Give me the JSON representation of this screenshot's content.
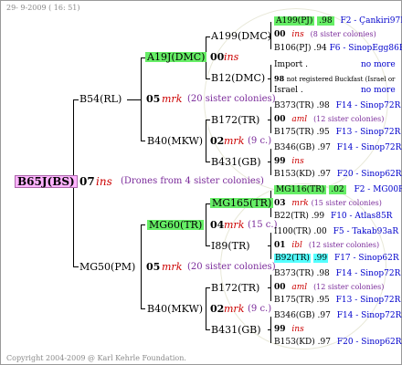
{
  "header": {
    "date": "29- 9-2009 ( 16: 51)"
  },
  "footer": {
    "copyright": "Copyright 2004-2009 @ Karl Kehrle Foundation."
  },
  "root": {
    "id": "B65J(BS)",
    "gen": "07",
    "species": "ins",
    "note": "(Drones from 4 sister colonies)"
  },
  "g1": [
    {
      "id": "B54(RL)"
    },
    {
      "id": "MG50(PM)",
      "gen": "05",
      "species": "mrk",
      "note": "(20 sister colonies)"
    }
  ],
  "g1a": {
    "gen": "05",
    "species": "mrk",
    "note": "(20 sister colonies)"
  },
  "g2": {
    "a": {
      "id": "A19J(DMC)"
    },
    "b": {
      "id": "B40(MKW)",
      "gen": "02",
      "species": "mrk",
      "note": "(9 c.)"
    },
    "c": {
      "id": "MG60(TR)",
      "gen": "04",
      "species": "mrk",
      "note": "(15 c.)"
    },
    "d": {
      "id": "B40(MKW)",
      "gen": "02",
      "species": "mrk",
      "note": "(9 c.)"
    }
  },
  "g3": {
    "a1": {
      "id": "A199(DMC)"
    },
    "a2": {
      "id": "B12(DMC)"
    },
    "b1": {
      "id": "B172(TR)"
    },
    "b2": {
      "id": "B431(GB)"
    },
    "c1": {
      "id": "MG165(TR)"
    },
    "c2": {
      "id": "I89(TR)"
    },
    "d1": {
      "id": "B172(TR)"
    },
    "d2": {
      "id": "B431(GB)"
    }
  },
  "g3a1_line": {
    "gen": "00",
    "species": "ins"
  },
  "g4": [
    {
      "id": "A199(PJ)",
      "val": ".98",
      "loc": "F2 - Çankiri97R"
    },
    {
      "gen": "00",
      "species": "ins",
      "note": "(8 sister colonies)"
    },
    {
      "id": "B106(PJ)",
      "val": ".94",
      "loc": "F6 - SinopEgg86R"
    },
    {
      "id": "Import",
      "dot": ".",
      "loc": "no more"
    },
    {
      "gen": "98",
      "note": "not registered Buckfast (Israel or"
    },
    {
      "id": "Israel",
      "dot": ".",
      "loc": "no more"
    },
    {
      "id": "B373(TR)",
      "val": ".98",
      "loc": "F14 - Sinop72R"
    },
    {
      "gen": "00",
      "species": "aml",
      "note": "(12 sister colonies)"
    },
    {
      "id": "B175(TR)",
      "val": ".95",
      "loc": "F13 - Sinop72R"
    },
    {
      "id": "B346(GB)",
      "val": ".97",
      "loc": "F14 - Sinop72R"
    },
    {
      "gen": "99",
      "species": "ins"
    },
    {
      "id": "B153(KD)",
      "val": ".97",
      "loc": "F20 - Sinop62R"
    },
    {
      "id": "MG116(TR)",
      "val": ".02",
      "loc": "F2 - MG00R"
    },
    {
      "gen": "03",
      "species": "mrk",
      "note": "(15 sister colonies)"
    },
    {
      "id": "B22(TR)",
      "val": ".99",
      "loc": "F10 - Atlas85R"
    },
    {
      "id": "I100(TR)",
      "val": ".00",
      "loc": "F5 - Takab93aR"
    },
    {
      "gen": "01",
      "species": "ibl",
      "note": "(12 sister colonies)"
    },
    {
      "id": "B92(TR)",
      "val": ".99",
      "loc": "F17 - Sinop62R"
    },
    {
      "id": "B373(TR)",
      "val": ".98",
      "loc": "F14 - Sinop72R"
    },
    {
      "gen": "00",
      "species": "aml",
      "note": "(12 sister colonies)"
    },
    {
      "id": "B175(TR)",
      "val": ".95",
      "loc": "F13 - Sinop72R"
    },
    {
      "id": "B346(GB)",
      "val": ".97",
      "loc": "F14 - Sinop72R"
    },
    {
      "gen": "99",
      "species": "ins"
    },
    {
      "id": "B153(KD)",
      "val": ".97",
      "loc": "F20 - Sinop62R"
    }
  ],
  "colors": {
    "root_bg": "#ffb3ff",
    "green": "#66ee66",
    "cyan": "#55ffff",
    "red": "#cc0000",
    "blue": "#0000cc",
    "purple": "#7a2a9a"
  }
}
